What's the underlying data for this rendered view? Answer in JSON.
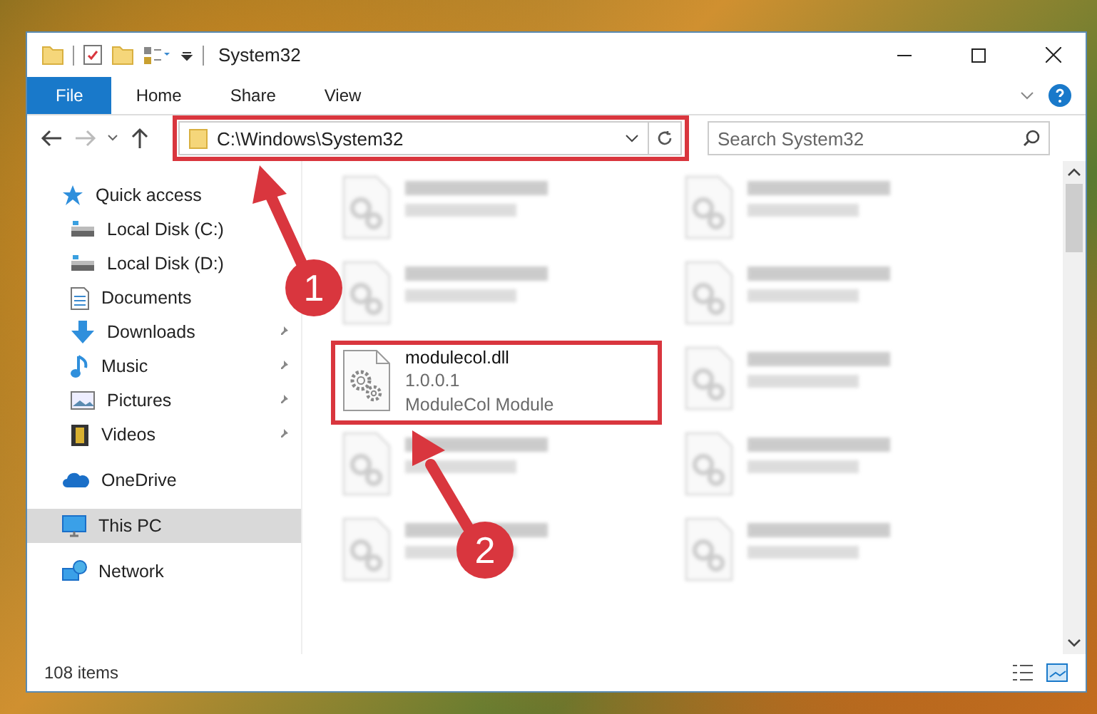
{
  "window": {
    "title": "System32"
  },
  "ribbon_tabs": [
    {
      "label": "File",
      "kind": "file-menu"
    },
    {
      "label": "Home",
      "kind": "tab"
    },
    {
      "label": "Share",
      "kind": "tab"
    },
    {
      "label": "View",
      "kind": "tab"
    }
  ],
  "address_bar": {
    "path": "C:\\Windows\\System32"
  },
  "search": {
    "placeholder": "Search System32"
  },
  "nav": [
    {
      "label": "Quick access",
      "kind": "star",
      "selected": false,
      "children": [
        {
          "label": "Local Disk (C:)",
          "kind": "drive"
        },
        {
          "label": "Local Disk (D:)",
          "kind": "drive"
        },
        {
          "label": "Documents",
          "kind": "document"
        },
        {
          "label": "Downloads",
          "kind": "download",
          "pinned": true
        },
        {
          "label": "Music",
          "kind": "music",
          "pinned": true
        },
        {
          "label": "Pictures",
          "kind": "picture",
          "pinned": true
        },
        {
          "label": "Videos",
          "kind": "video",
          "pinned": true
        }
      ]
    },
    {
      "label": "OneDrive",
      "kind": "cloud",
      "selected": false
    },
    {
      "label": "This PC",
      "kind": "computer",
      "selected": true
    },
    {
      "label": "Network",
      "kind": "network",
      "selected": false
    }
  ],
  "files": [
    {
      "kind": "blurred"
    },
    {
      "kind": "blurred"
    },
    {
      "kind": "blurred"
    },
    {
      "kind": "blurred"
    },
    {
      "kind": "file",
      "name": "modulecol.dll",
      "details": [
        "1.0.0.1",
        "ModuleCol Module"
      ]
    },
    {
      "kind": "blurred"
    },
    {
      "kind": "blurred"
    },
    {
      "kind": "blurred"
    },
    {
      "kind": "blurred"
    },
    {
      "kind": "blurred"
    }
  ],
  "status_bar": {
    "count": "108 items"
  },
  "annotations": [
    {
      "label": "1"
    },
    {
      "label": "2"
    }
  ]
}
